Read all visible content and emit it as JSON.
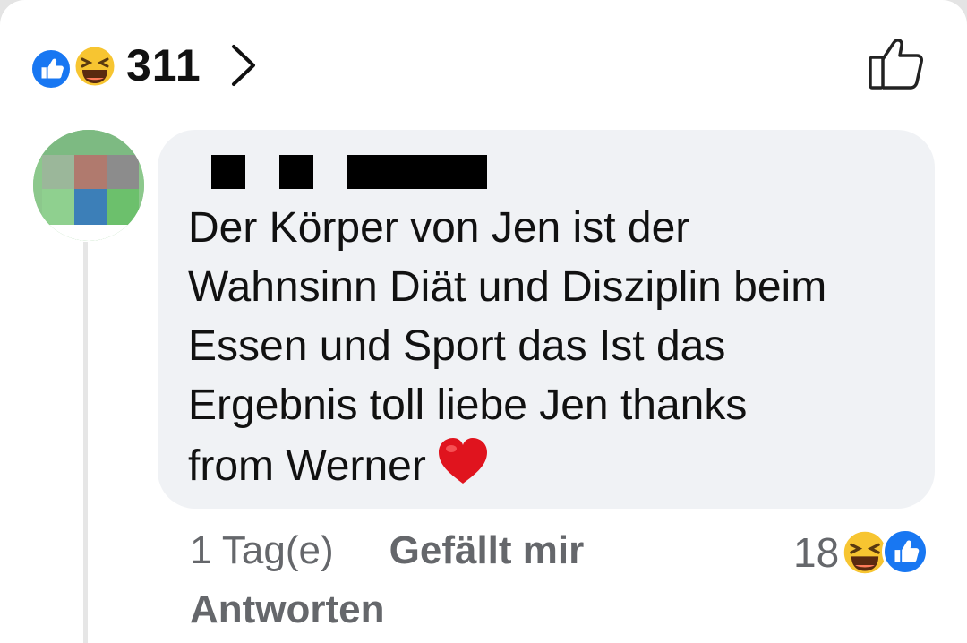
{
  "header": {
    "reaction_count": "311",
    "reactions": [
      "like-icon",
      "laugh-emoji-icon"
    ]
  },
  "comment": {
    "text": "Der Körper von Jen ist der\nWahnsinn Diät und Disziplin beim\nEssen und Sport das Ist das\nErgebnis toll liebe Jen thanks\nfrom Werner",
    "emoji": "red-heart-icon",
    "timestamp": "1 Tag(e)",
    "like_label": "Gefällt mir",
    "reply_label": "Antworten",
    "reaction_count": "18",
    "reactions": [
      "laugh-emoji-icon",
      "like-icon"
    ]
  },
  "colors": {
    "facebook_blue": "#1877f2",
    "bubble_bg": "#f0f2f5",
    "meta_text": "#65676b"
  }
}
